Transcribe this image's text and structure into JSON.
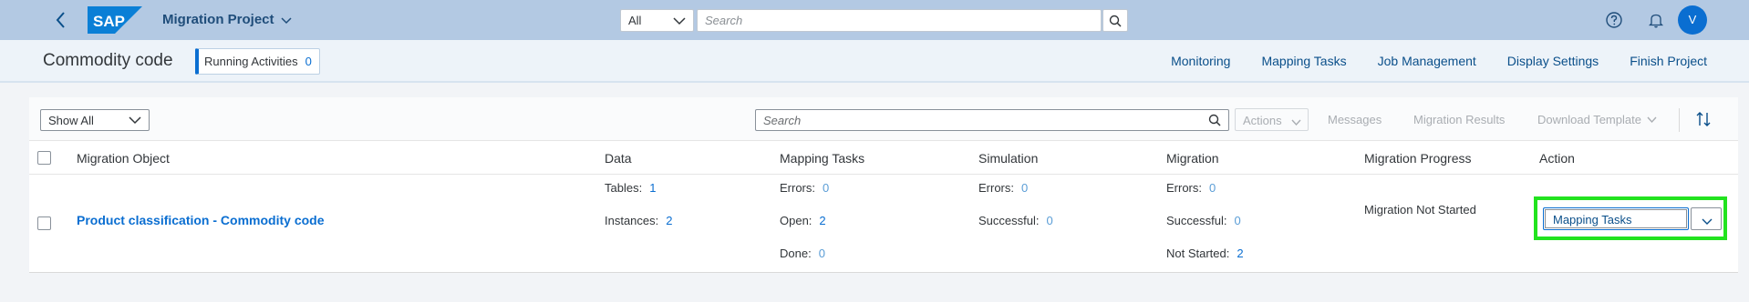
{
  "shell": {
    "app_title": "Migration Project",
    "scope_value": "All",
    "search_placeholder": "Search",
    "avatar_initial": "V"
  },
  "subheader": {
    "title": "Commodity code",
    "running_label": "Running Activities",
    "running_count": "0",
    "nav": [
      "Monitoring",
      "Mapping Tasks",
      "Job Management",
      "Display Settings",
      "Finish Project"
    ]
  },
  "toolbar": {
    "filter_value": "Show All",
    "search_placeholder": "Search",
    "actions_label": "Actions",
    "messages_label": "Messages",
    "results_label": "Migration Results",
    "download_label": "Download Template"
  },
  "table": {
    "columns": [
      "Migration Object",
      "Data",
      "Mapping Tasks",
      "Simulation",
      "Migration",
      "Migration Progress",
      "Action"
    ],
    "row": {
      "object": "Product classification - Commodity code",
      "data": {
        "tables_label": "Tables:",
        "tables": "1",
        "instances_label": "Instances:",
        "instances": "2"
      },
      "mapping": {
        "errors_label": "Errors:",
        "errors": "0",
        "open_label": "Open:",
        "open": "2",
        "done_label": "Done:",
        "done": "0"
      },
      "simulation": {
        "errors_label": "Errors:",
        "errors": "0",
        "successful_label": "Successful:",
        "successful": "0"
      },
      "migration": {
        "errors_label": "Errors:",
        "errors": "0",
        "successful_label": "Successful:",
        "successful": "0",
        "notstarted_label": "Not Started:",
        "notstarted": "2"
      },
      "progress": "Migration Not Started",
      "action_button": "Mapping Tasks"
    }
  }
}
